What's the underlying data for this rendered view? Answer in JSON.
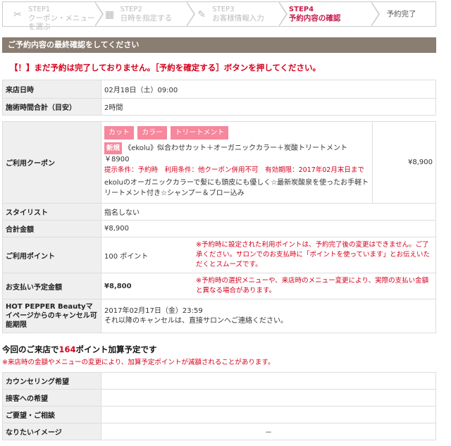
{
  "steps": [
    {
      "num": "STEP1",
      "title": "クーポン・メニューを選ぶ",
      "icon": "✂"
    },
    {
      "num": "STEP2",
      "title": "日時を指定する",
      "icon": "▦"
    },
    {
      "num": "STEP3",
      "title": "お客様情報入力",
      "icon": "✎"
    },
    {
      "num": "STEP4",
      "title": "予約内容の確認",
      "icon": ""
    },
    {
      "num": "",
      "title": "予約完了",
      "icon": ""
    }
  ],
  "header": "ご予約内容の最終確認をしてください",
  "warning": "【！】まだ予約は完了しておりません。［予約を確定する］ボタンを押してください。",
  "visit": {
    "label": "来店日時",
    "value": "02月18日（土）09:00"
  },
  "duration": {
    "label": "施術時間合計（目安）",
    "value": "2時間"
  },
  "coupon": {
    "label": "ご利用クーポン",
    "tags": [
      "カット",
      "カラー",
      "トリートメント"
    ],
    "new_badge": "新規",
    "name": "《ekolu》似合わせカット＋オーガニックカラー＋炭酸トリートメント￥8900",
    "cond1": "提示条件：予約時",
    "cond2": "利用条件：他クーポン併用不可",
    "cond3": "有効期限：2017年02月末日まで",
    "desc": "ekoluのオーガニックカラーで髪にも頭皮にも優しく☆最新炭酸泉を使ったお手軽トリートメント付き☆シャンプー＆ブロー込み",
    "price": "¥8,900"
  },
  "stylist": {
    "label": "スタイリスト",
    "value": "指名しない"
  },
  "total": {
    "label": "合計金額",
    "value": "¥8,900"
  },
  "points": {
    "label": "ご利用ポイント",
    "value": "100 ポイント",
    "note": "※予約時に設定された利用ポイントは、予約完了後の変更はできません。ご了承ください。サロンでのお支払時に「ポイントを使っています」とお伝えいただくとスムーズです。"
  },
  "payment": {
    "label": "お支払い予定金額",
    "value": "¥8,800",
    "note": "※予約時の選択メニューや、来店時のメニュー変更により、実際の支払い金額と異なる場合があります。"
  },
  "cancel": {
    "label": "HOT PEPPER Beautyマイページからのキャンセル可能期限",
    "value": "2017年02月17日（金）23:59",
    "value2": "それ以降のキャンセルは、直接サロンへご連絡ください。"
  },
  "summary": {
    "pre": "今回のご来店で",
    "points": "164",
    "post": "ポイント加算予定です"
  },
  "note": "※来店時の金額やメニューの変更により、加算予定ポイントが減額されることがあります。",
  "extra": [
    {
      "label": "カウンセリング希望",
      "value": ""
    },
    {
      "label": "接客への希望",
      "value": ""
    },
    {
      "label": "ご要望・ご相談",
      "value": ""
    },
    {
      "label": "なりたいイメージ",
      "value": "－"
    }
  ]
}
